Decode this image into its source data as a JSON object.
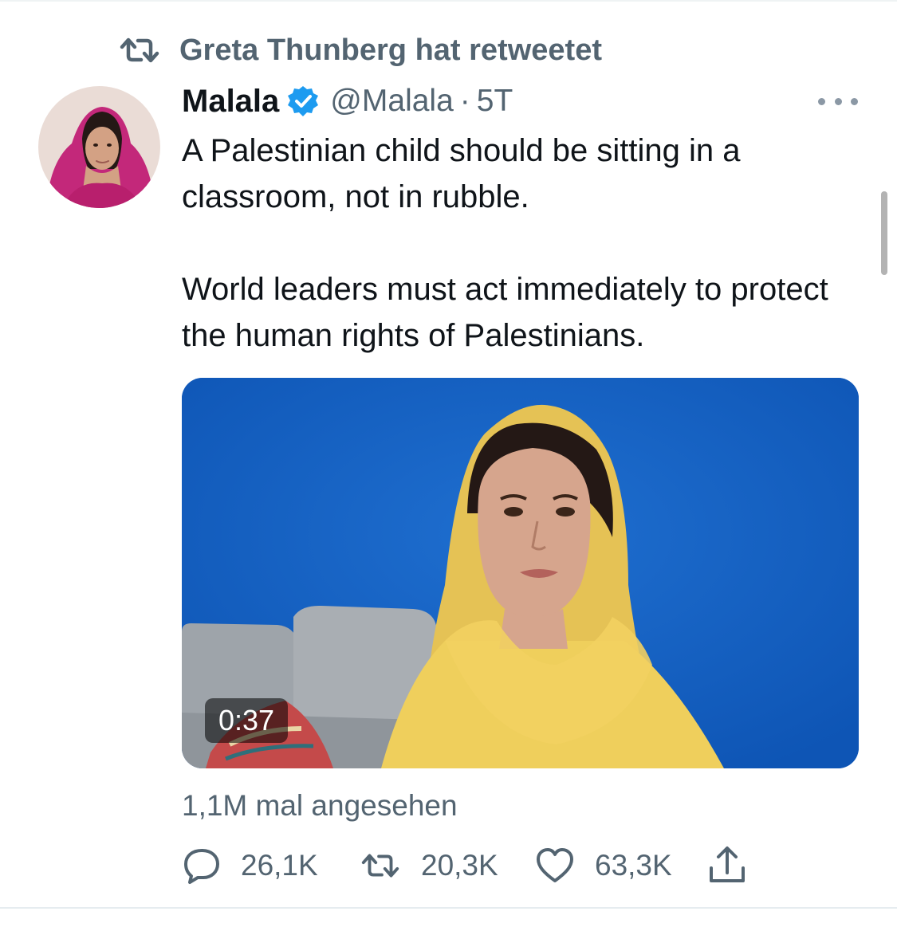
{
  "retweet": {
    "icon": "retweet-icon",
    "label": "Greta Thunberg hat retweetet"
  },
  "tweet": {
    "author_name": "Malala",
    "handle": "@Malala",
    "separator": "·",
    "time": "5T",
    "verified_icon": "verified-badge-icon",
    "text_para_1": "A Palestinian child should be sitting in a classroom, not in rubble.",
    "text_para_2": "World leaders must act immediately to protect the human rights of Palestinians."
  },
  "media": {
    "duration": "0:37"
  },
  "stats": {
    "views": "1,1M mal angesehen"
  },
  "actions": {
    "reply": {
      "icon": "reply-icon",
      "count": "26,1K"
    },
    "retweet": {
      "icon": "retweet-icon",
      "count": "20,3K"
    },
    "like": {
      "icon": "heart-icon",
      "count": "63,3K"
    },
    "share": {
      "icon": "share-icon"
    }
  },
  "colors": {
    "secondary_text": "#536471",
    "primary_text": "#0f1419",
    "verified": "#1d9bf0",
    "media_background": "#1560c4"
  }
}
